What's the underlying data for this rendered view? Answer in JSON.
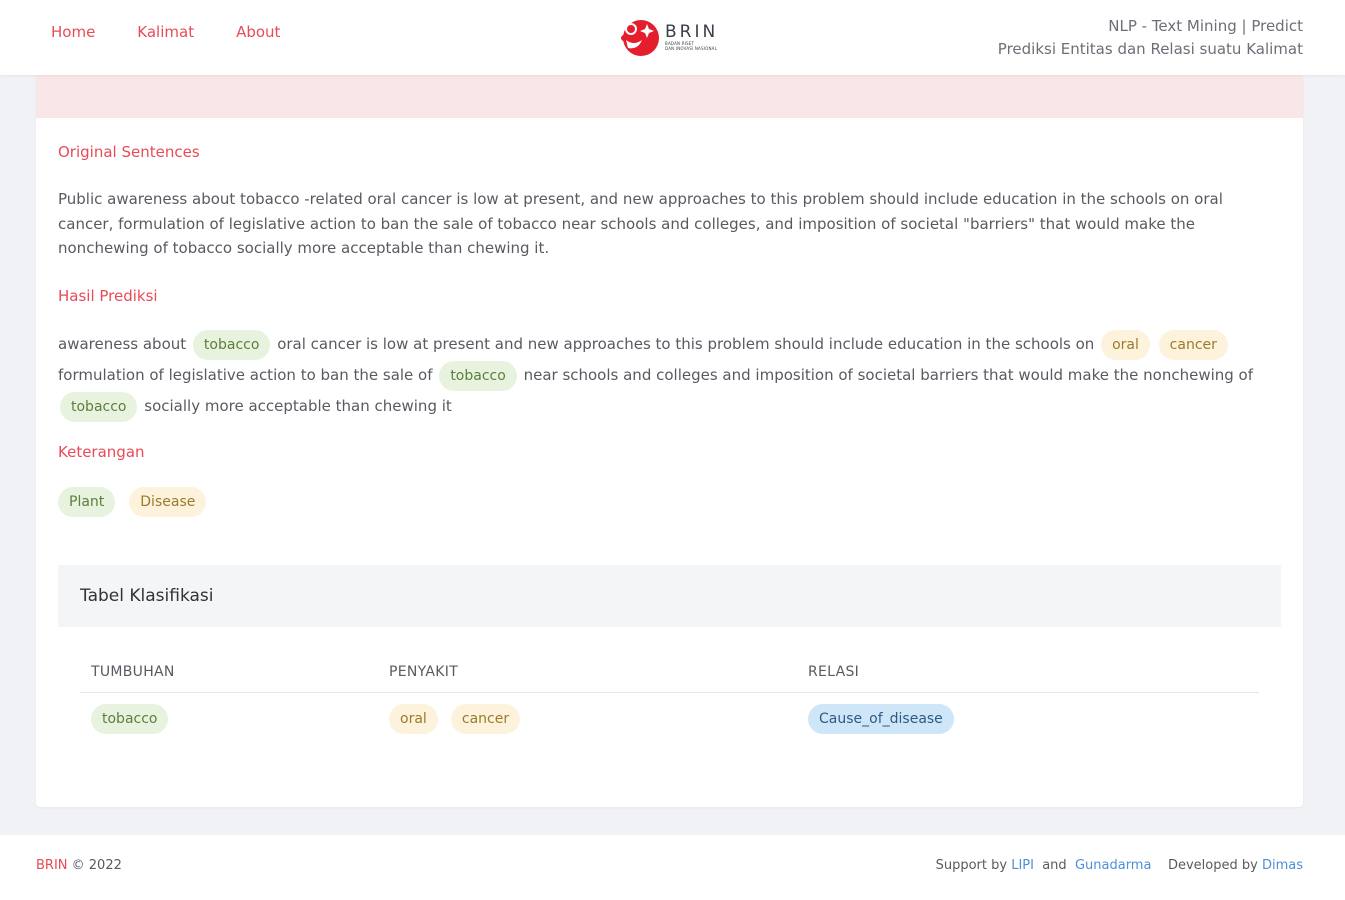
{
  "nav": {
    "home": "Home",
    "kalimat": "Kalimat",
    "about": "About"
  },
  "logo": {
    "word": "BRIN",
    "sub1": "BADAN RISET",
    "sub2": "DAN INOVASI NASIONAL",
    "icon": "brin-logo-icon"
  },
  "header": {
    "line1": "NLP - Text Mining | Predict",
    "line2": "Prediksi Entitas dan Relasi suatu Kalimat"
  },
  "sections": {
    "original": "Original Sentences",
    "prediksi": "Hasil Prediksi",
    "keterangan": "Keterangan"
  },
  "original_text": "Public awareness about tobacco -related oral cancer is low at present, and new approaches to this problem should include education in the schools on oral cancer, formulation of legislative action to ban the sale of tobacco near schools and colleges, and imposition of societal \"barriers\" that would make the nonchewing of tobacco socially more acceptable than chewing it.",
  "prediction": {
    "t0": "awareness about",
    "e1": "tobacco",
    "t1": "oral cancer is low at present and new approaches to this problem should include education in the schools on",
    "e2": "oral",
    "e3": "cancer",
    "t2": "formulation of legislative action to ban the sale of",
    "e4": "tobacco",
    "t3": "near schools and colleges and imposition of societal barriers that would make the nonchewing of",
    "e5": "tobacco",
    "t4": "socially more acceptable than chewing it"
  },
  "legend": {
    "plant": "Plant",
    "disease": "Disease"
  },
  "table": {
    "title": "Tabel Klasifikasi",
    "headers": [
      "TUMBUHAN",
      "PENYAKIT",
      "RELASI"
    ],
    "row": {
      "plant": "tobacco",
      "disease1": "oral",
      "disease2": "cancer",
      "relation": "Cause_of_disease"
    }
  },
  "footer": {
    "brand": "BRIN",
    "copyright": "© 2022",
    "support": "Support by",
    "lipi": "LIPI",
    "and": "and",
    "gunadarma": "Gunadarma",
    "developed": "Developed by",
    "dimas": "Dimas"
  },
  "colors": {
    "accent": "#e84b57",
    "plant_bg": "#e7f2df",
    "disease_bg": "#fdf3dd",
    "relation_bg": "#cfe5f8",
    "link": "#4f8fd8"
  }
}
